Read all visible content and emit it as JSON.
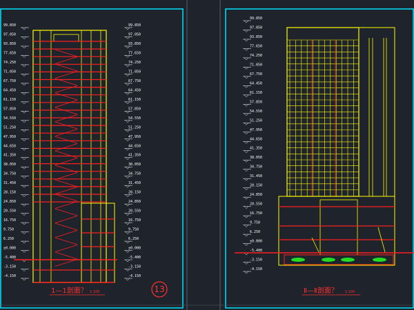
{
  "colors": {
    "background": "#1f232b",
    "frame": "#00e5ff",
    "structure": "#ffff00",
    "floor_slab": "#ff2020",
    "text": "#ffffff",
    "title": "#ff3030",
    "green_fill": "#22dd22"
  },
  "section_1": {
    "title": "1—1剖面？",
    "scale": "1:100",
    "sheet_badge": "13",
    "levels_left": [
      "99.850",
      "97.050",
      "93.850",
      "77.650",
      "74.250",
      "71.050",
      "67.750",
      "64.450",
      "61.150",
      "57.850",
      "54.550",
      "51.250",
      "47.950",
      "44.650",
      "41.350",
      "38.050",
      "34.750",
      "31.450",
      "28.150",
      "24.850",
      "20.550",
      "16.750",
      "9.750",
      "6.250",
      "±0.000",
      "-5.400",
      "-3.150",
      "-4.150"
    ],
    "levels_right": [
      "99.850",
      "97.050",
      "93.850",
      "77.650",
      "74.250",
      "71.050",
      "67.750",
      "64.450",
      "61.150",
      "57.850",
      "54.550",
      "51.250",
      "47.950",
      "44.650",
      "41.350",
      "38.050",
      "34.750",
      "31.450",
      "28.150",
      "24.850",
      "20.550",
      "16.750",
      "9.750",
      "6.250",
      "±0.000",
      "-5.400",
      "-3.150",
      "-4.150"
    ]
  },
  "section_2": {
    "title": "Ⅱ—Ⅱ剖面？",
    "scale": "1:100",
    "levels_left": [
      "99.850",
      "97.050",
      "93.850",
      "77.650",
      "74.250",
      "71.050",
      "67.750",
      "64.450",
      "61.150",
      "57.850",
      "54.550",
      "51.250",
      "47.950",
      "44.650",
      "41.350",
      "38.050",
      "34.750",
      "31.450",
      "28.150",
      "24.850",
      "20.550",
      "16.750",
      "9.750",
      "6.250",
      "±0.000",
      "-5.400",
      "-3.150",
      "-4.150"
    ]
  }
}
